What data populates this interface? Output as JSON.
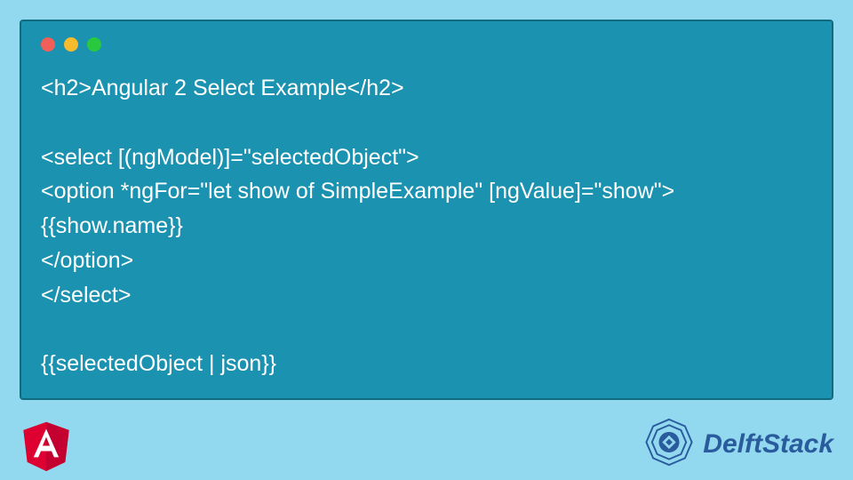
{
  "code_lines": [
    "<h2>Angular 2 Select Example</h2>",
    "",
    "<select [(ngModel)]=\"selectedObject\">",
    "<option *ngFor=\"let show of SimpleExample\" [ngValue]=\"show\">",
    "{{show.name}}",
    "</option>",
    "</select>",
    "",
    "{{selectedObject | json}}"
  ],
  "brand": {
    "name": "DelftStack"
  },
  "colors": {
    "page_bg": "#92d9f0",
    "card_bg": "#1b92b0",
    "card_border": "#116b80",
    "text": "#ffffff",
    "brand_text": "#2a5b9c",
    "angular_red": "#dd0031",
    "angular_red_dark": "#c3002f"
  },
  "window_dots": [
    "#f25f58",
    "#f8bb2e",
    "#28c93f"
  ]
}
